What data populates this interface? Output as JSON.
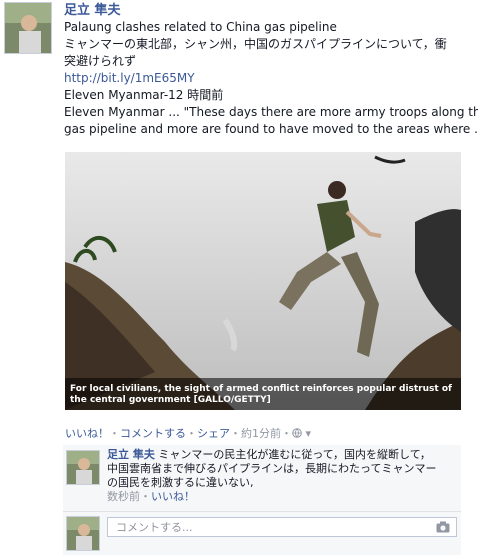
{
  "post": {
    "author": "足立 隼夫",
    "link_title": "Palaung clashes related to China gas pipeline",
    "message": "ミャンマーの東北部，シャン州，中国のガスパイプラインについて，衝",
    "message_cont": "突避けられず",
    "url": "http://bit.ly/1mE65MY",
    "source_line": "Eleven Myanmar-12 時間前",
    "excerpt_line1": "Eleven Myanmar ... \"These days there are more army troops along the",
    "excerpt_line2": "gas pipeline and more are found to have moved to the areas where ...",
    "photo_caption": "For local civilians, the sight of armed conflict reinforces popular distrust of the central government [GALLO/GETTY]"
  },
  "actions": {
    "like": "いいね！",
    "comment": "コメントする",
    "share": "シェア",
    "time": "約1分前",
    "sep": "・"
  },
  "comment": {
    "author": "足立 隼夫",
    "text_line1": "ミャンマーの民主化が進むに従って，国内を縦断して，",
    "text_line2": "中国雲南省まで伸びるパイプラインは，長期にわたってミャンマー",
    "text_line3": "の国民を刺激するに違いない,",
    "time": "数秒前",
    "like": "いいね！"
  },
  "reply": {
    "placeholder": "コメントする..."
  },
  "colors": {
    "link": "#3b5998",
    "meta": "#9197a3",
    "ufi_bg": "#f6f7f9"
  }
}
